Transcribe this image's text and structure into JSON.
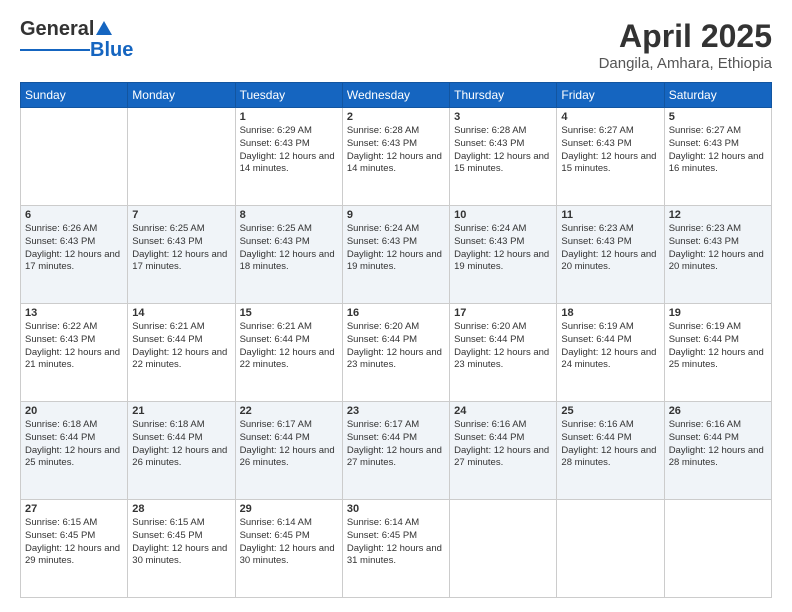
{
  "header": {
    "logo_general": "General",
    "logo_blue": "Blue",
    "title": "April 2025",
    "subtitle": "Dangila, Amhara, Ethiopia"
  },
  "days_of_week": [
    "Sunday",
    "Monday",
    "Tuesday",
    "Wednesday",
    "Thursday",
    "Friday",
    "Saturday"
  ],
  "weeks": [
    [
      {
        "day": "",
        "info": ""
      },
      {
        "day": "",
        "info": ""
      },
      {
        "day": "1",
        "info": "Sunrise: 6:29 AM\nSunset: 6:43 PM\nDaylight: 12 hours and 14 minutes."
      },
      {
        "day": "2",
        "info": "Sunrise: 6:28 AM\nSunset: 6:43 PM\nDaylight: 12 hours and 14 minutes."
      },
      {
        "day": "3",
        "info": "Sunrise: 6:28 AM\nSunset: 6:43 PM\nDaylight: 12 hours and 15 minutes."
      },
      {
        "day": "4",
        "info": "Sunrise: 6:27 AM\nSunset: 6:43 PM\nDaylight: 12 hours and 15 minutes."
      },
      {
        "day": "5",
        "info": "Sunrise: 6:27 AM\nSunset: 6:43 PM\nDaylight: 12 hours and 16 minutes."
      }
    ],
    [
      {
        "day": "6",
        "info": "Sunrise: 6:26 AM\nSunset: 6:43 PM\nDaylight: 12 hours and 17 minutes."
      },
      {
        "day": "7",
        "info": "Sunrise: 6:25 AM\nSunset: 6:43 PM\nDaylight: 12 hours and 17 minutes."
      },
      {
        "day": "8",
        "info": "Sunrise: 6:25 AM\nSunset: 6:43 PM\nDaylight: 12 hours and 18 minutes."
      },
      {
        "day": "9",
        "info": "Sunrise: 6:24 AM\nSunset: 6:43 PM\nDaylight: 12 hours and 19 minutes."
      },
      {
        "day": "10",
        "info": "Sunrise: 6:24 AM\nSunset: 6:43 PM\nDaylight: 12 hours and 19 minutes."
      },
      {
        "day": "11",
        "info": "Sunrise: 6:23 AM\nSunset: 6:43 PM\nDaylight: 12 hours and 20 minutes."
      },
      {
        "day": "12",
        "info": "Sunrise: 6:23 AM\nSunset: 6:43 PM\nDaylight: 12 hours and 20 minutes."
      }
    ],
    [
      {
        "day": "13",
        "info": "Sunrise: 6:22 AM\nSunset: 6:43 PM\nDaylight: 12 hours and 21 minutes."
      },
      {
        "day": "14",
        "info": "Sunrise: 6:21 AM\nSunset: 6:44 PM\nDaylight: 12 hours and 22 minutes."
      },
      {
        "day": "15",
        "info": "Sunrise: 6:21 AM\nSunset: 6:44 PM\nDaylight: 12 hours and 22 minutes."
      },
      {
        "day": "16",
        "info": "Sunrise: 6:20 AM\nSunset: 6:44 PM\nDaylight: 12 hours and 23 minutes."
      },
      {
        "day": "17",
        "info": "Sunrise: 6:20 AM\nSunset: 6:44 PM\nDaylight: 12 hours and 23 minutes."
      },
      {
        "day": "18",
        "info": "Sunrise: 6:19 AM\nSunset: 6:44 PM\nDaylight: 12 hours and 24 minutes."
      },
      {
        "day": "19",
        "info": "Sunrise: 6:19 AM\nSunset: 6:44 PM\nDaylight: 12 hours and 25 minutes."
      }
    ],
    [
      {
        "day": "20",
        "info": "Sunrise: 6:18 AM\nSunset: 6:44 PM\nDaylight: 12 hours and 25 minutes."
      },
      {
        "day": "21",
        "info": "Sunrise: 6:18 AM\nSunset: 6:44 PM\nDaylight: 12 hours and 26 minutes."
      },
      {
        "day": "22",
        "info": "Sunrise: 6:17 AM\nSunset: 6:44 PM\nDaylight: 12 hours and 26 minutes."
      },
      {
        "day": "23",
        "info": "Sunrise: 6:17 AM\nSunset: 6:44 PM\nDaylight: 12 hours and 27 minutes."
      },
      {
        "day": "24",
        "info": "Sunrise: 6:16 AM\nSunset: 6:44 PM\nDaylight: 12 hours and 27 minutes."
      },
      {
        "day": "25",
        "info": "Sunrise: 6:16 AM\nSunset: 6:44 PM\nDaylight: 12 hours and 28 minutes."
      },
      {
        "day": "26",
        "info": "Sunrise: 6:16 AM\nSunset: 6:44 PM\nDaylight: 12 hours and 28 minutes."
      }
    ],
    [
      {
        "day": "27",
        "info": "Sunrise: 6:15 AM\nSunset: 6:45 PM\nDaylight: 12 hours and 29 minutes."
      },
      {
        "day": "28",
        "info": "Sunrise: 6:15 AM\nSunset: 6:45 PM\nDaylight: 12 hours and 30 minutes."
      },
      {
        "day": "29",
        "info": "Sunrise: 6:14 AM\nSunset: 6:45 PM\nDaylight: 12 hours and 30 minutes."
      },
      {
        "day": "30",
        "info": "Sunrise: 6:14 AM\nSunset: 6:45 PM\nDaylight: 12 hours and 31 minutes."
      },
      {
        "day": "",
        "info": ""
      },
      {
        "day": "",
        "info": ""
      },
      {
        "day": "",
        "info": ""
      }
    ]
  ]
}
